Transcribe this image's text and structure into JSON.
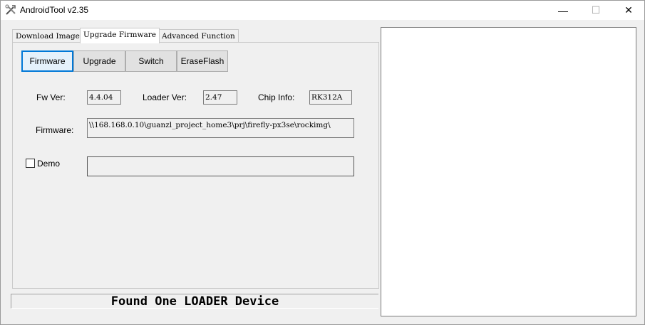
{
  "window": {
    "title": "AndroidTool v2.35",
    "minimize_glyph": "—",
    "maximize_glyph": "☐",
    "close_glyph": "✕",
    "icon": "tools-icon"
  },
  "tabs": [
    {
      "label": "Download Image",
      "active": false
    },
    {
      "label": "Upgrade Firmware",
      "active": true
    },
    {
      "label": "Advanced Function",
      "active": false
    }
  ],
  "buttons": {
    "firmware": "Firmware",
    "upgrade": "Upgrade",
    "switch": "Switch",
    "erase_flash": "EraseFlash"
  },
  "info": {
    "fw_ver_label": "Fw Ver:",
    "fw_ver_value": "4.4.04",
    "loader_ver_label": "Loader Ver:",
    "loader_ver_value": "2.47",
    "chip_info_label": "Chip Info:",
    "chip_info_value": "RK312A",
    "firmware_label": "Firmware:",
    "firmware_path": "\\\\168.168.0.10\\guanzl_project_home3\\prj\\firefly-px3se\\rockimg\\"
  },
  "demo": {
    "label": "Demo",
    "checked": false
  },
  "progress": {
    "fraction": 0
  },
  "status": {
    "text": "Found One LOADER Device"
  },
  "colors": {
    "accent": "#0078d7",
    "window_bg": "#f0f0f0"
  }
}
